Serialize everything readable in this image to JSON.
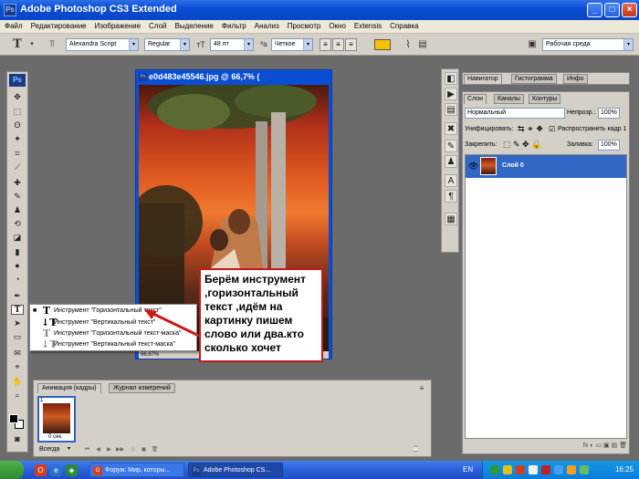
{
  "window": {
    "title": "Adobe Photoshop CS3 Extended",
    "app_icon": "Ps"
  },
  "menu": [
    "Файл",
    "Редактирование",
    "Изображение",
    "Слой",
    "Выделение",
    "Фильтр",
    "Анализ",
    "Просмотр",
    "Окно",
    "Extensis",
    "Справка"
  ],
  "options": {
    "font_family": "Alexandra Script",
    "font_style": "Regular",
    "font_size": "48 пт",
    "antialias": "Четкое",
    "text_color": "#f7c000",
    "workspace": "Рабочая среда"
  },
  "tools": {
    "logo": "Ps"
  },
  "document": {
    "title": "e0d483e45546.jpg @ 66,7% (",
    "status": "66,67%"
  },
  "flyout": {
    "items": [
      {
        "label": "Инструмент \"Горизонтальный текст\"",
        "selected": true
      },
      {
        "label": "Инструмент \"Вертикальный текст\"",
        "selected": false
      },
      {
        "label": "Инструмент \"Горизонтальный текст-маска\"",
        "selected": false
      },
      {
        "label": "Инструмент \"Вертикальный текст-маска\"",
        "selected": false
      }
    ],
    "selected_mark": "■"
  },
  "callout": {
    "text": "Берём инструмент ,горизонтальный текст ,идём на картинку пишем слово или два.кто сколько хочет"
  },
  "animation": {
    "tabs": [
      "Анимация (кадры)",
      "Журнал измерений"
    ],
    "frame_number": "1",
    "frame_delay": "0 сек.",
    "loop": "Всегда"
  },
  "navigator": {
    "tabs": [
      "Навигатор",
      "Гистограмма",
      "Инфо"
    ]
  },
  "layers": {
    "tabs": [
      "Слои",
      "Каналы",
      "Контуры"
    ],
    "blend_mode": "Нормальный",
    "opacity_label": "Непрозр.:",
    "opacity": "100%",
    "unify_label": "Унифицировать:",
    "propagate_label": "Распространить кадр 1",
    "lock_label": "Закрепить:",
    "fill_label": "Заливка:",
    "fill": "100%",
    "layer_name": "Слой 0",
    "footer_icons": "fx  ◐  ▭  ▣  ▤  🗑"
  },
  "taskbar": {
    "tasks": [
      {
        "label": "Форум: Мир, которы...",
        "active": false
      },
      {
        "label": "Adobe Photoshop CS...",
        "active": true
      }
    ],
    "language": "EN",
    "time": "16:25"
  }
}
